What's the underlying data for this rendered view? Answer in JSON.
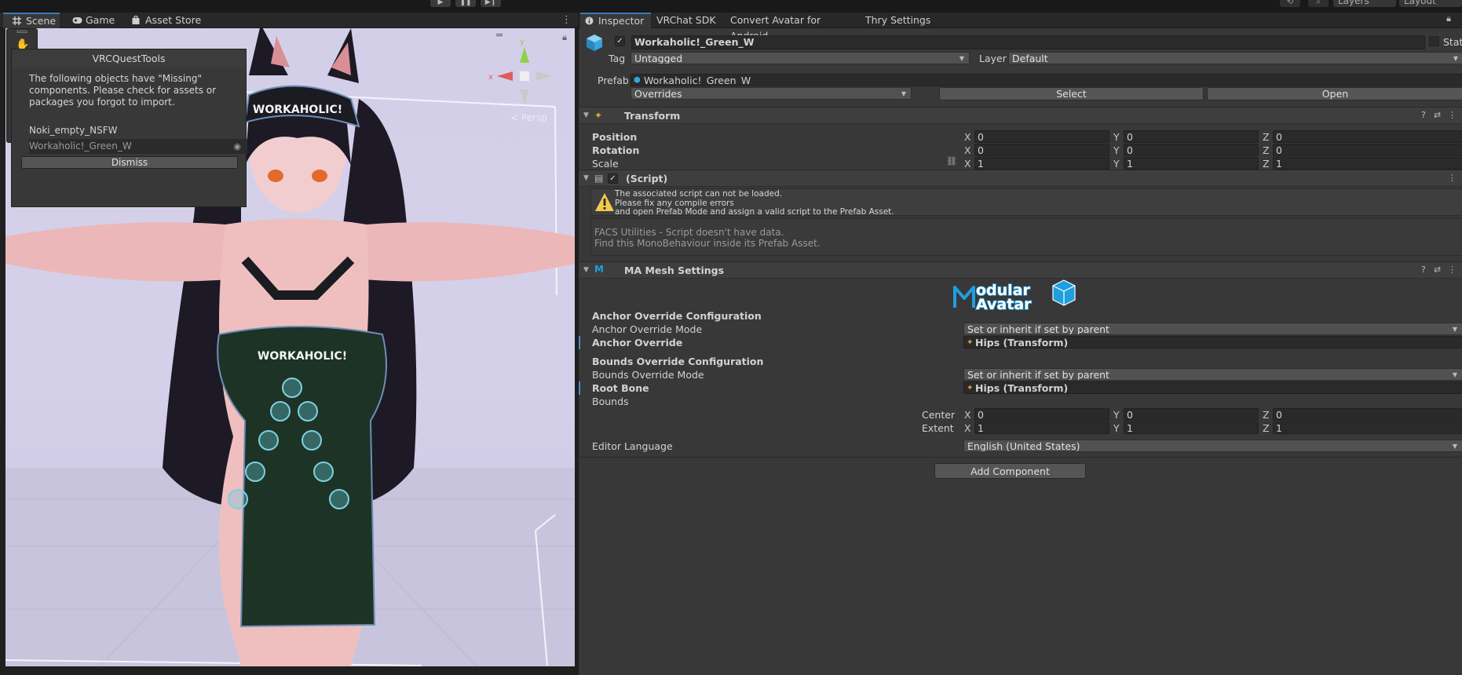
{
  "scene_panel": {
    "tabs": [
      {
        "label": "Scene",
        "icon": "scene-grid-icon"
      },
      {
        "label": "Game",
        "icon": "gamepad-icon"
      },
      {
        "label": "Asset Store",
        "icon": "shopping-bag-icon"
      }
    ],
    "viewport_text": {
      "visor": "WORKAHOLIC!",
      "apron": "WORKAHOLIC!",
      "persp": "< Persp"
    },
    "gizmo_axes": {
      "x": "x",
      "y": "y"
    },
    "tools": [
      {
        "name": "hand-tool",
        "glyph": "✋"
      },
      {
        "name": "move-tool",
        "glyph": "✥"
      },
      {
        "name": "rotate-tool",
        "glyph": "⟳"
      },
      {
        "name": "scale-tool",
        "glyph": "⤢"
      },
      {
        "name": "rect-tool",
        "glyph": "⬚"
      },
      {
        "name": "transform-tool",
        "glyph": "⊕"
      }
    ],
    "quest_tools": {
      "title": "VRCQuestTools",
      "message": "The following objects have \"Missing\" components. Please check for assets or packages you forgot to import.",
      "objects": [
        "Noki_empty_NSFW",
        "Workaholic!_Green_W"
      ],
      "dismiss_label": "Dismiss"
    }
  },
  "inspector": {
    "tabs": [
      {
        "label": "Inspector",
        "icon": "info-icon"
      },
      {
        "label": "VRChat SDK"
      },
      {
        "label": "Convert Avatar for Android"
      },
      {
        "label": "Thry Settings"
      }
    ],
    "object": {
      "name": "Workaholic!_Green_W",
      "active": true,
      "static_label": "Static",
      "tag_label": "Tag",
      "tag_value": "Untagged",
      "layer_label": "Layer",
      "layer_value": "Default"
    },
    "prefab": {
      "label": "Prefab",
      "name": "Workaholic!_Green_W",
      "overrides_label": "Overrides",
      "select_label": "Select",
      "open_label": "Open"
    },
    "transform": {
      "title": "Transform",
      "rows": [
        {
          "label": "Position",
          "x": "0",
          "y": "0",
          "z": "0"
        },
        {
          "label": "Rotation",
          "x": "0",
          "y": "0",
          "z": "0"
        },
        {
          "label": "Scale",
          "x": "1",
          "y": "1",
          "z": "1"
        }
      ],
      "axis_x": "X",
      "axis_y": "Y",
      "axis_z": "Z"
    },
    "missing_script": {
      "title": "(Script)",
      "warning_lines": [
        "The associated script can not be loaded.",
        "Please fix any compile errors",
        "and open Prefab Mode and assign a valid script to the Prefab Asset."
      ],
      "info_lines": [
        "FACS Utilities - Script doesn't have data.",
        "Find this MonoBehaviour inside its Prefab Asset."
      ]
    },
    "ma_mesh_settings": {
      "title": "MA Mesh Settings",
      "logo_line1": "odular",
      "logo_line2": "Avatar",
      "anchor_section": "Anchor Override Configuration",
      "anchor_mode_label": "Anchor Override Mode",
      "anchor_mode_value": "Set or inherit if set by parent",
      "anchor_override_label": "Anchor Override",
      "anchor_override_value": "Hips (Transform)",
      "bounds_section": "Bounds Override Configuration",
      "bounds_mode_label": "Bounds Override Mode",
      "bounds_mode_value": "Set or inherit if set by parent",
      "root_bone_label": "Root Bone",
      "root_bone_value": "Hips (Transform)",
      "bounds_label": "Bounds",
      "center_label": "Center",
      "center": {
        "x": "0",
        "y": "0",
        "z": "0"
      },
      "extent_label": "Extent",
      "extent": {
        "x": "1",
        "y": "1",
        "z": "1"
      },
      "editor_language_label": "Editor Language",
      "editor_language_value": "English (United States)"
    },
    "add_component_label": "Add Component"
  },
  "toolbar": {
    "layers_label": "Layers",
    "layout_label": "Layout"
  },
  "colors": {
    "accent": "#3a79bb",
    "panel": "#383838",
    "ma_logo_blue": "#1f9fe0"
  }
}
